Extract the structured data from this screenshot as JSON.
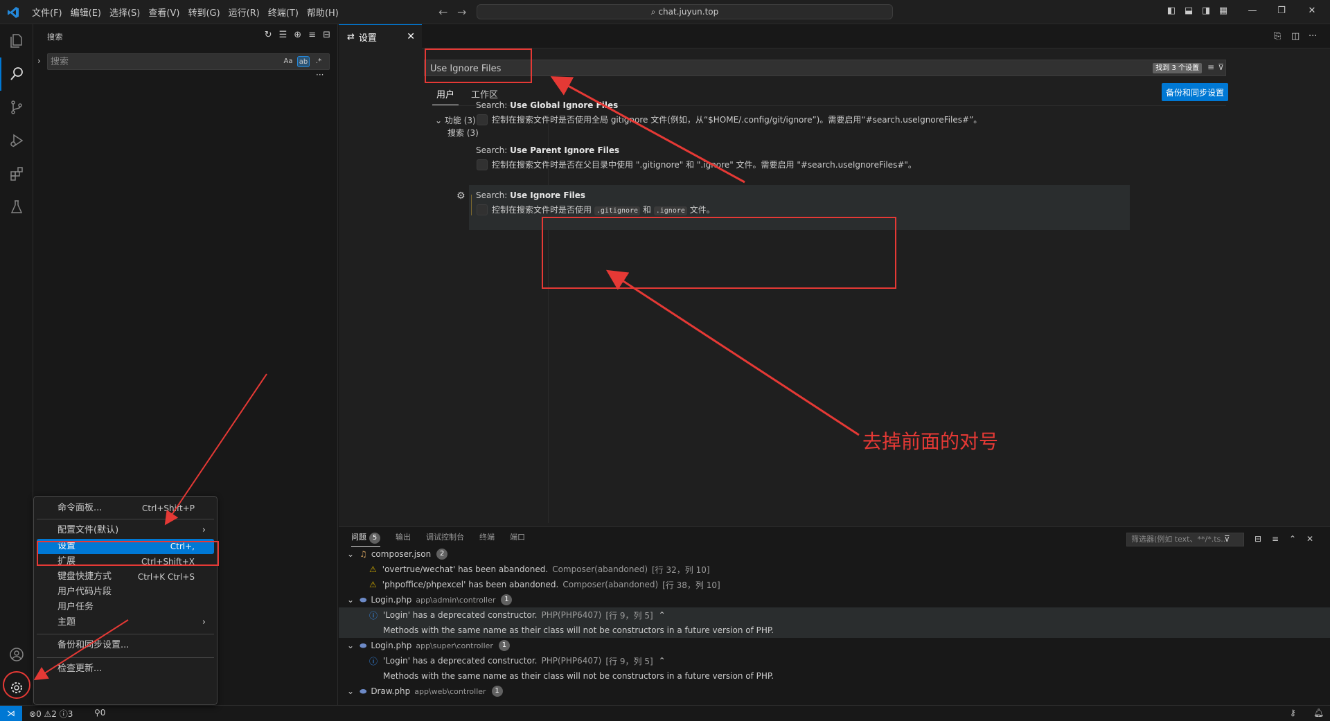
{
  "titlebar": {
    "menus": [
      "文件(F)",
      "编辑(E)",
      "选择(S)",
      "查看(V)",
      "转到(G)",
      "运行(R)",
      "终端(T)",
      "帮助(H)"
    ],
    "command_center": "chat.juyun.top"
  },
  "sidebar": {
    "title": "搜索",
    "search_placeholder": "搜索",
    "opt_case": "Aa",
    "opt_word": "ab",
    "opt_regex": ".*"
  },
  "editor": {
    "tab_label": "设置",
    "settings_search_value": "Use Ignore Files",
    "found_badge": "找到 3 个设置",
    "scope_tabs": [
      "用户",
      "工作区"
    ],
    "sync_button": "备份和同步设置",
    "toc": {
      "group": "功能 (3)",
      "item": "搜索 (3)"
    },
    "settings": [
      {
        "prefix": "Search: ",
        "name": "Use Global Ignore Files",
        "desc": "控制在搜索文件时是否使用全局 gitignore 文件(例如，从“$HOME/.config/git/ignore”)。需要启用“#search.useIgnoreFiles#”。"
      },
      {
        "prefix": "Search: ",
        "name": "Use Parent Ignore Files",
        "desc": "控制在搜索文件时是否在父目录中使用 \".gitignore\" 和 \".ignore\" 文件。需要启用 \"#search.useIgnoreFiles#\"。"
      },
      {
        "prefix": "Search: ",
        "name": "Use Ignore Files",
        "desc_a": "控制在搜索文件时是否使用",
        "code1": ".gitignore",
        "desc_b": "和",
        "code2": ".ignore",
        "desc_c": "文件。"
      }
    ]
  },
  "panel": {
    "tabs": [
      "问题",
      "输出",
      "调试控制台",
      "终端",
      "端口"
    ],
    "problems_count": "5",
    "filter_placeholder": "筛选器(例如 text、**/*.ts...",
    "rows": [
      {
        "kind": "file",
        "name": "composer.json",
        "path": "",
        "count": "2"
      },
      {
        "kind": "warn",
        "text": "'overtrue/wechat' has been abandoned.",
        "src": "Composer(abandoned)",
        "loc": "[行 32，列 10]"
      },
      {
        "kind": "warn",
        "text": "'phpoffice/phpexcel' has been abandoned.",
        "src": "Composer(abandoned)",
        "loc": "[行 38，列 10]"
      },
      {
        "kind": "file",
        "name": "Login.php",
        "path": "app\\admin\\controller",
        "count": "1"
      },
      {
        "kind": "info",
        "text": "'Login' has a deprecated constructor.",
        "src": "PHP(PHP6407)",
        "loc": "[行 9，列 5]"
      },
      {
        "kind": "detail",
        "text": "Methods with the same name as their class will not be constructors in a future version of PHP."
      },
      {
        "kind": "file",
        "name": "Login.php",
        "path": "app\\super\\controller",
        "count": "1"
      },
      {
        "kind": "info",
        "text": "'Login' has a deprecated constructor.",
        "src": "PHP(PHP6407)",
        "loc": "[行 9，列 5]"
      },
      {
        "kind": "detail",
        "text": "Methods with the same name as their class will not be constructors in a future version of PHP."
      },
      {
        "kind": "file",
        "name": "Draw.php",
        "path": "app\\web\\controller",
        "count": "1"
      }
    ]
  },
  "menu": {
    "items": [
      {
        "label": "命令面板...",
        "kb": "Ctrl+Shift+P"
      },
      {
        "label": "配置文件(默认)",
        "kb": ""
      },
      {
        "label": "设置",
        "kb": "Ctrl+,"
      },
      {
        "label": "扩展",
        "kb": "Ctrl+Shift+X"
      },
      {
        "label": "键盘快捷方式",
        "kb": "Ctrl+K Ctrl+S"
      },
      {
        "label": "用户代码片段",
        "kb": ""
      },
      {
        "label": "用户任务",
        "kb": ""
      },
      {
        "label": "主题",
        "kb": ""
      },
      {
        "label": "备份和同步设置...",
        "kb": ""
      },
      {
        "label": "检查更新...",
        "kb": ""
      }
    ]
  },
  "statusbar": {
    "errors": "0",
    "warnings": "2",
    "infos": "3",
    "ports": "0"
  },
  "annotation": {
    "text": "去掉前面的对号",
    "color": "#e53935"
  },
  "colors": {
    "accent": "#0078d4",
    "warning": "#cca700",
    "info": "#3794ff"
  }
}
